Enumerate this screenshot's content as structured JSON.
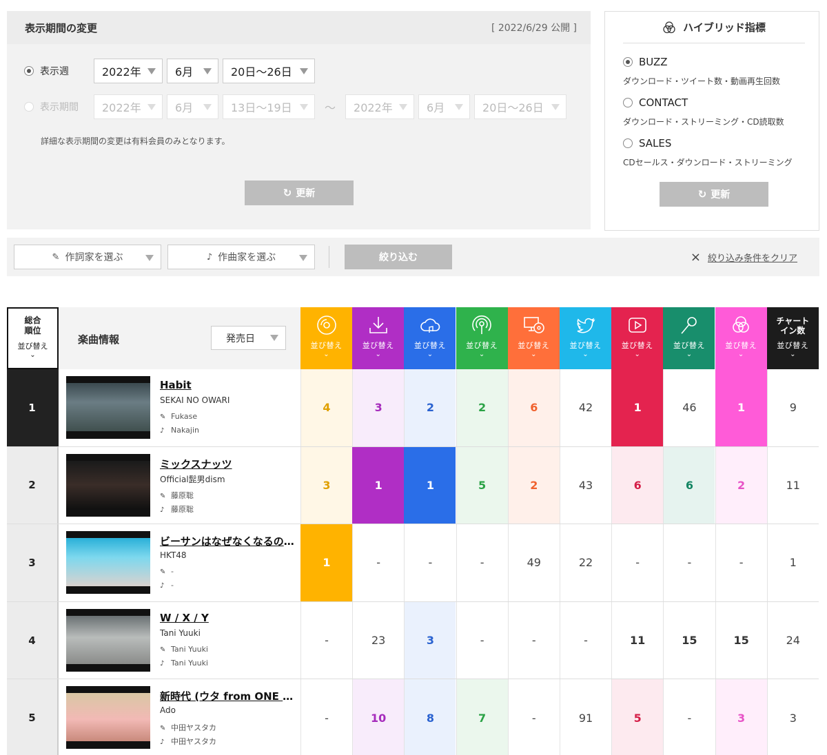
{
  "period": {
    "title": "表示期間の変更",
    "published": "[ 2022/6/29 公開 ]",
    "week_label": "表示週",
    "week_year": "2022年",
    "week_month": "6月",
    "week_range": "20日〜26日",
    "range_label": "表示期間",
    "from_year": "2022年",
    "from_month": "6月",
    "from_range": "13日〜19日",
    "tilde": "〜",
    "to_year": "2022年",
    "to_month": "6月",
    "to_range": "20日〜26日",
    "note": "詳細な表示期間の変更は有料会員のみとなります。",
    "update_label": "更新"
  },
  "hybrid": {
    "title": "ハイブリッド指標",
    "options": [
      {
        "label": "BUZZ",
        "desc": "ダウンロード・ツイート数・動画再生回数",
        "selected": true
      },
      {
        "label": "CONTACT",
        "desc": "ダウンロード・ストリーミング・CD読取数",
        "selected": false
      },
      {
        "label": "SALES",
        "desc": "CDセールス・ダウンロード・ストリーミング",
        "selected": false
      }
    ],
    "update_label": "更新"
  },
  "filter": {
    "lyricist_placeholder": "作詞家を選ぶ",
    "composer_placeholder": "作曲家を選ぶ",
    "narrow_label": "絞り込む",
    "clear_label": "絞り込み条件をクリア"
  },
  "table": {
    "rank_header_1": "総合",
    "rank_header_2": "順位",
    "sort_label": "並び替え",
    "info_header": "楽曲情報",
    "date_select": "発売日",
    "chart_in_1": "チャート",
    "chart_in_2": "イン数",
    "metrics": [
      {
        "icon": "cd-icon",
        "color": "#ffb300",
        "light": "#fff7e6",
        "text": "#e0a000"
      },
      {
        "icon": "download-icon",
        "color": "#b02ec5",
        "light": "#f8ecfb",
        "text": "#a62cbc"
      },
      {
        "icon": "cloud-music-icon",
        "color": "#2a6ee8",
        "light": "#eaf1fd",
        "text": "#2a62d0"
      },
      {
        "icon": "broadcast-icon",
        "color": "#2fb24c",
        "light": "#ebf7ed",
        "text": "#2aa245"
      },
      {
        "icon": "pc-cd-icon",
        "color": "#ff6f3a",
        "light": "#fff0ea",
        "text": "#f0612e"
      },
      {
        "icon": "twitter-icon",
        "color": "#1fb8ea",
        "light": "#e8f7fd",
        "text": "#444444"
      },
      {
        "icon": "video-play-icon",
        "color": "#e4234f",
        "light": "#fdeaef",
        "text": "#d51f48"
      },
      {
        "icon": "microphone-icon",
        "color": "#188e6c",
        "light": "#e6f3ef",
        "text": "#148563"
      },
      {
        "icon": "hybrid-icon",
        "color": "#ff5bd8",
        "light": "#ffeefb",
        "text": "#e752c6"
      },
      {
        "icon": "chart-in-count",
        "color": "#1c1c1c",
        "light": "#ffffff",
        "text": "#444444"
      }
    ],
    "rows": [
      {
        "rank": "1",
        "title": "Habit",
        "artist": "SEKAI NO OWARI",
        "lyricist": "Fukase",
        "composer": "Nakajin",
        "values": [
          "4",
          "3",
          "2",
          "2",
          "6",
          "42",
          "1",
          "46",
          "1",
          "9"
        ],
        "styles": [
          "light",
          "light",
          "light",
          "light",
          "light",
          "plain",
          "full",
          "plain",
          "full",
          "plain"
        ]
      },
      {
        "rank": "2",
        "title": "ミックスナッツ",
        "artist": "Official髭男dism",
        "lyricist": "藤原聡",
        "composer": "藤原聡",
        "values": [
          "3",
          "1",
          "1",
          "5",
          "2",
          "43",
          "6",
          "6",
          "2",
          "11"
        ],
        "styles": [
          "light",
          "full",
          "full",
          "light",
          "light",
          "plain",
          "light",
          "light",
          "light",
          "plain"
        ]
      },
      {
        "rank": "3",
        "title": "ビーサンはなぜなくなるのか？",
        "artist": "HKT48",
        "lyricist": "-",
        "composer": "-",
        "values": [
          "1",
          "-",
          "-",
          "-",
          "49",
          "22",
          "-",
          "-",
          "-",
          "1"
        ],
        "styles": [
          "full",
          "plain",
          "plain",
          "plain",
          "plain",
          "plain",
          "plain",
          "plain",
          "plain",
          "plain"
        ]
      },
      {
        "rank": "4",
        "title": "W / X / Y",
        "artist": "Tani Yuuki",
        "lyricist": "Tani Yuuki",
        "composer": "Tani Yuuki",
        "values": [
          "-",
          "23",
          "3",
          "-",
          "-",
          "-",
          "11",
          "15",
          "15",
          "24"
        ],
        "styles": [
          "plain",
          "plain",
          "light",
          "plain",
          "plain",
          "plain",
          "boldplain",
          "boldplain",
          "boldplain",
          "plain"
        ]
      },
      {
        "rank": "5",
        "title": "新時代 (ウタ from ONE PIECE FILM RED)",
        "artist": "Ado",
        "lyricist": "中田ヤスタカ",
        "composer": "中田ヤスタカ",
        "values": [
          "-",
          "10",
          "8",
          "7",
          "-",
          "91",
          "5",
          "-",
          "3",
          "3"
        ],
        "styles": [
          "plain",
          "light",
          "light",
          "light",
          "plain",
          "plain",
          "light",
          "plain",
          "light",
          "plain"
        ]
      }
    ]
  }
}
